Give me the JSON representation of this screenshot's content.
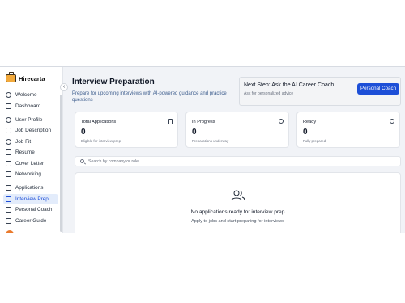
{
  "app": {
    "name": "Hirecarta"
  },
  "sidebar": {
    "items": [
      {
        "label": "Welcome",
        "icon": "heart-icon"
      },
      {
        "label": "Dashboard",
        "icon": "dashboard-icon"
      },
      {
        "label": "User Profile",
        "icon": "user-icon"
      },
      {
        "label": "Job Description",
        "icon": "document-icon"
      },
      {
        "label": "Job Fit",
        "icon": "target-icon"
      },
      {
        "label": "Resume",
        "icon": "resume-icon"
      },
      {
        "label": "Cover Letter",
        "icon": "mail-icon"
      },
      {
        "label": "Networking",
        "icon": "network-icon"
      },
      {
        "label": "Applications",
        "icon": "clipboard-icon"
      },
      {
        "label": "Interview Prep",
        "icon": "chat-icon",
        "active": true
      },
      {
        "label": "Personal Coach",
        "icon": "message-icon"
      },
      {
        "label": "Career Guide",
        "icon": "book-icon"
      }
    ]
  },
  "header": {
    "title": "Interview Preparation",
    "subtitle": "Prepare for upcoming interviews with AI-powered guidance and practice questions"
  },
  "coach": {
    "title": "Next Step: Ask the AI Career Coach",
    "subtitle": "Ask for personalized advice",
    "button_label": "Personal Coach",
    "button_color": "#1d4fd7"
  },
  "stats": [
    {
      "label": "Total Applications",
      "value": "0",
      "note": "Eligible for interview prep",
      "icon": "document-icon"
    },
    {
      "label": "In Progress",
      "value": "0",
      "note": "Preparations underway",
      "icon": "clock-icon"
    },
    {
      "label": "Ready",
      "value": "0",
      "note": "Fully prepared",
      "icon": "check-circle-icon"
    }
  ],
  "search": {
    "placeholder": "Search by company or role..."
  },
  "empty_state": {
    "title": "No applications ready for interview prep",
    "subtitle": "Apply to jobs and start preparing for interviews",
    "icon": "users-icon"
  }
}
